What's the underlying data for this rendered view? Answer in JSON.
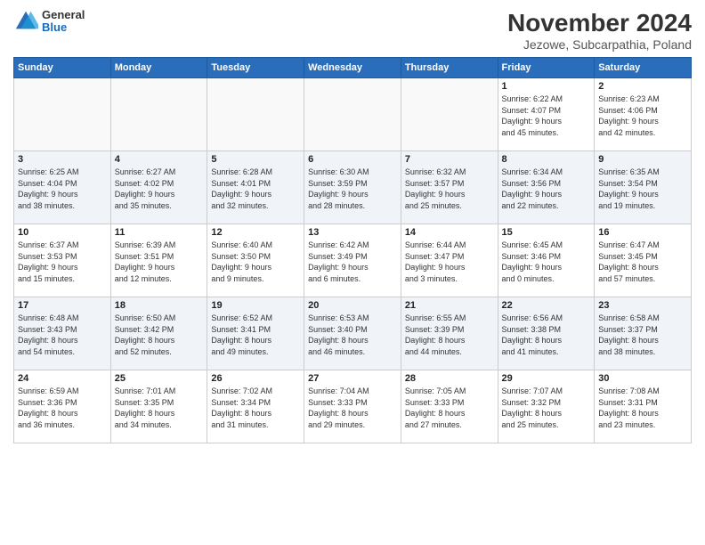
{
  "logo": {
    "general": "General",
    "blue": "Blue"
  },
  "title": "November 2024",
  "location": "Jezowe, Subcarpathia, Poland",
  "header_days": [
    "Sunday",
    "Monday",
    "Tuesday",
    "Wednesday",
    "Thursday",
    "Friday",
    "Saturday"
  ],
  "weeks": [
    [
      {
        "day": "",
        "info": ""
      },
      {
        "day": "",
        "info": ""
      },
      {
        "day": "",
        "info": ""
      },
      {
        "day": "",
        "info": ""
      },
      {
        "day": "",
        "info": ""
      },
      {
        "day": "1",
        "info": "Sunrise: 6:22 AM\nSunset: 4:07 PM\nDaylight: 9 hours\nand 45 minutes."
      },
      {
        "day": "2",
        "info": "Sunrise: 6:23 AM\nSunset: 4:06 PM\nDaylight: 9 hours\nand 42 minutes."
      }
    ],
    [
      {
        "day": "3",
        "info": "Sunrise: 6:25 AM\nSunset: 4:04 PM\nDaylight: 9 hours\nand 38 minutes."
      },
      {
        "day": "4",
        "info": "Sunrise: 6:27 AM\nSunset: 4:02 PM\nDaylight: 9 hours\nand 35 minutes."
      },
      {
        "day": "5",
        "info": "Sunrise: 6:28 AM\nSunset: 4:01 PM\nDaylight: 9 hours\nand 32 minutes."
      },
      {
        "day": "6",
        "info": "Sunrise: 6:30 AM\nSunset: 3:59 PM\nDaylight: 9 hours\nand 28 minutes."
      },
      {
        "day": "7",
        "info": "Sunrise: 6:32 AM\nSunset: 3:57 PM\nDaylight: 9 hours\nand 25 minutes."
      },
      {
        "day": "8",
        "info": "Sunrise: 6:34 AM\nSunset: 3:56 PM\nDaylight: 9 hours\nand 22 minutes."
      },
      {
        "day": "9",
        "info": "Sunrise: 6:35 AM\nSunset: 3:54 PM\nDaylight: 9 hours\nand 19 minutes."
      }
    ],
    [
      {
        "day": "10",
        "info": "Sunrise: 6:37 AM\nSunset: 3:53 PM\nDaylight: 9 hours\nand 15 minutes."
      },
      {
        "day": "11",
        "info": "Sunrise: 6:39 AM\nSunset: 3:51 PM\nDaylight: 9 hours\nand 12 minutes."
      },
      {
        "day": "12",
        "info": "Sunrise: 6:40 AM\nSunset: 3:50 PM\nDaylight: 9 hours\nand 9 minutes."
      },
      {
        "day": "13",
        "info": "Sunrise: 6:42 AM\nSunset: 3:49 PM\nDaylight: 9 hours\nand 6 minutes."
      },
      {
        "day": "14",
        "info": "Sunrise: 6:44 AM\nSunset: 3:47 PM\nDaylight: 9 hours\nand 3 minutes."
      },
      {
        "day": "15",
        "info": "Sunrise: 6:45 AM\nSunset: 3:46 PM\nDaylight: 9 hours\nand 0 minutes."
      },
      {
        "day": "16",
        "info": "Sunrise: 6:47 AM\nSunset: 3:45 PM\nDaylight: 8 hours\nand 57 minutes."
      }
    ],
    [
      {
        "day": "17",
        "info": "Sunrise: 6:48 AM\nSunset: 3:43 PM\nDaylight: 8 hours\nand 54 minutes."
      },
      {
        "day": "18",
        "info": "Sunrise: 6:50 AM\nSunset: 3:42 PM\nDaylight: 8 hours\nand 52 minutes."
      },
      {
        "day": "19",
        "info": "Sunrise: 6:52 AM\nSunset: 3:41 PM\nDaylight: 8 hours\nand 49 minutes."
      },
      {
        "day": "20",
        "info": "Sunrise: 6:53 AM\nSunset: 3:40 PM\nDaylight: 8 hours\nand 46 minutes."
      },
      {
        "day": "21",
        "info": "Sunrise: 6:55 AM\nSunset: 3:39 PM\nDaylight: 8 hours\nand 44 minutes."
      },
      {
        "day": "22",
        "info": "Sunrise: 6:56 AM\nSunset: 3:38 PM\nDaylight: 8 hours\nand 41 minutes."
      },
      {
        "day": "23",
        "info": "Sunrise: 6:58 AM\nSunset: 3:37 PM\nDaylight: 8 hours\nand 38 minutes."
      }
    ],
    [
      {
        "day": "24",
        "info": "Sunrise: 6:59 AM\nSunset: 3:36 PM\nDaylight: 8 hours\nand 36 minutes."
      },
      {
        "day": "25",
        "info": "Sunrise: 7:01 AM\nSunset: 3:35 PM\nDaylight: 8 hours\nand 34 minutes."
      },
      {
        "day": "26",
        "info": "Sunrise: 7:02 AM\nSunset: 3:34 PM\nDaylight: 8 hours\nand 31 minutes."
      },
      {
        "day": "27",
        "info": "Sunrise: 7:04 AM\nSunset: 3:33 PM\nDaylight: 8 hours\nand 29 minutes."
      },
      {
        "day": "28",
        "info": "Sunrise: 7:05 AM\nSunset: 3:33 PM\nDaylight: 8 hours\nand 27 minutes."
      },
      {
        "day": "29",
        "info": "Sunrise: 7:07 AM\nSunset: 3:32 PM\nDaylight: 8 hours\nand 25 minutes."
      },
      {
        "day": "30",
        "info": "Sunrise: 7:08 AM\nSunset: 3:31 PM\nDaylight: 8 hours\nand 23 minutes."
      }
    ]
  ]
}
